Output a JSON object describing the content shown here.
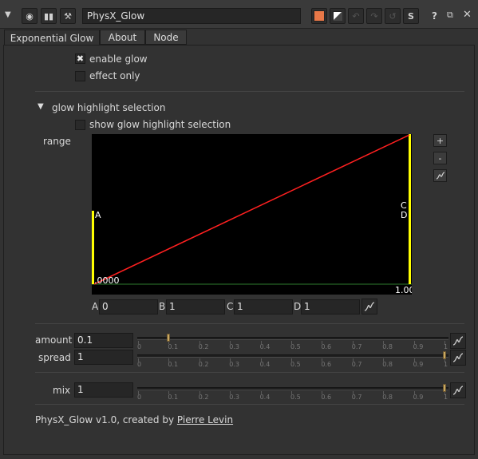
{
  "header": {
    "node_name": "PhysX_Glow"
  },
  "tabs": [
    "Exponential Glow",
    "About",
    "Node"
  ],
  "options": {
    "enable_glow": {
      "label": "enable glow",
      "checked": true
    },
    "effect_only": {
      "label": "effect only",
      "checked": false
    }
  },
  "group": {
    "title": "glow highlight selection",
    "show_label": "show glow highlight selection",
    "show_checked": false
  },
  "range": {
    "label": "range",
    "left_bottom": ".0000",
    "right_bottom": "1.00",
    "left_marker": "A",
    "right_marker_top": "C",
    "right_marker_bottom": "D",
    "buttons": {
      "add": "+",
      "remove": "-"
    },
    "fields": [
      {
        "label": "A",
        "value": "0"
      },
      {
        "label": "B",
        "value": "1"
      },
      {
        "label": "C",
        "value": "1"
      },
      {
        "label": "D",
        "value": "1"
      }
    ]
  },
  "sliders": [
    {
      "label": "amount",
      "value": "0.1",
      "level": 0.1
    },
    {
      "label": "spread",
      "value": "1",
      "level": 1
    },
    {
      "label": "mix",
      "value": "1",
      "level": 1
    }
  ],
  "slider_ticks": [
    "0",
    "0.1",
    "0.2",
    "0.3",
    "0.4",
    "0.5",
    "0.6",
    "0.7",
    "0.8",
    "0.9",
    "1"
  ],
  "footer": {
    "text": "PhysX_Glow v1.0, created by ",
    "author": "Pierre Levin"
  },
  "colors": {
    "curve_line": "#ff2020",
    "curve_edges": "#ffff00",
    "baseline": "#2e7d2e",
    "knob": "#c8a860"
  }
}
